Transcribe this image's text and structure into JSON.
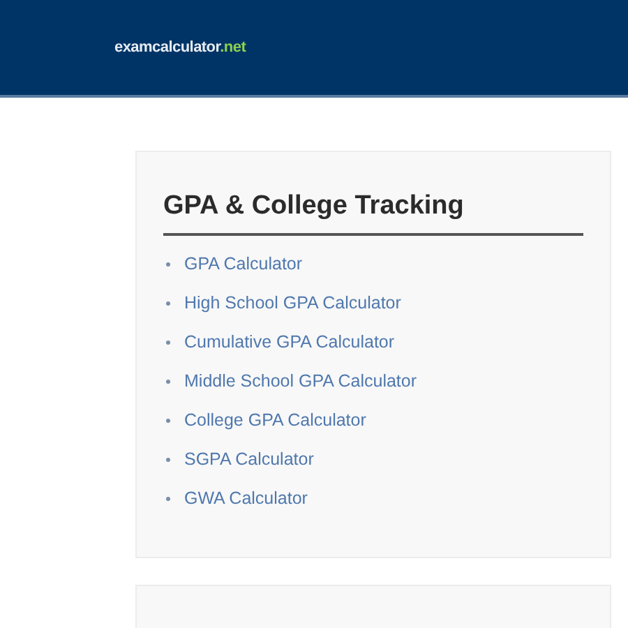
{
  "header": {
    "logo": {
      "name": "examcalculator",
      "tld": ".net"
    }
  },
  "card": {
    "title": "GPA & College Tracking",
    "links": [
      "GPA Calculator",
      "High School GPA Calculator",
      "Cumulative GPA Calculator",
      "Middle School GPA Calculator",
      "College GPA Calculator",
      "SGPA Calculator",
      "GWA Calculator"
    ]
  }
}
